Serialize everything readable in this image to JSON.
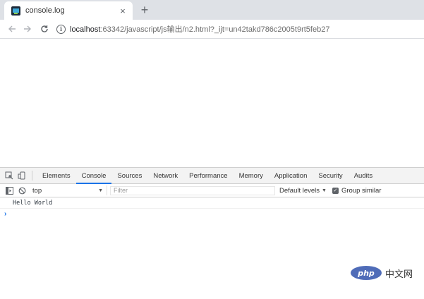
{
  "browser": {
    "tab": {
      "title": "console.log"
    },
    "new_tab_symbol": "+",
    "close_symbol": "×",
    "url": {
      "host": "localhost",
      "rest": ":63342/javascript/js输出/n2.html?_ijt=un42takd786c2005t9rt5feb27"
    }
  },
  "devtools": {
    "tabs": [
      "Elements",
      "Console",
      "Sources",
      "Network",
      "Performance",
      "Memory",
      "Application",
      "Security",
      "Audits"
    ],
    "active_tab": "Console",
    "console_bar": {
      "context": "top",
      "filter_placeholder": "Filter",
      "levels_label": "Default levels",
      "group_similar_label": "Group similar",
      "group_similar_checked": true
    },
    "console_output": [
      "Hello World"
    ],
    "prompt_symbol": "›"
  },
  "watermark": {
    "logo_text": "php",
    "text": "中文网"
  },
  "colors": {
    "accent": "#1a73e8",
    "tabstrip": "#dee1e6",
    "watermark_logo": "#4f6cb8"
  }
}
